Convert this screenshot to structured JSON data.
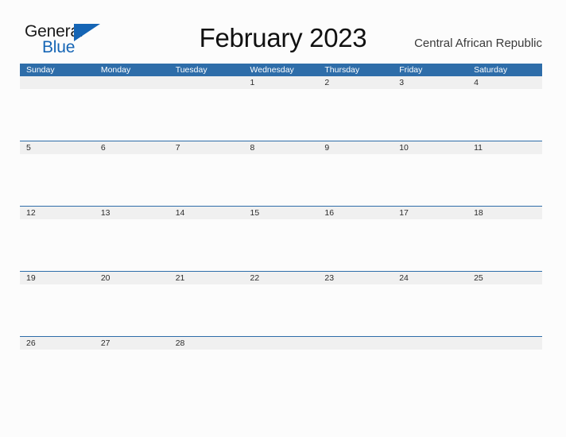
{
  "brand": {
    "name_part1": "General",
    "name_part2": "Blue",
    "flag_icon": "blue-triangle-flag-icon",
    "accent_color": "#1565b5"
  },
  "header": {
    "title": "February 2023",
    "region": "Central African Republic"
  },
  "theme": {
    "header_blue": "#2e6da9",
    "date_band_gray": "#f0f0f0",
    "page_background": "#fcfcfc",
    "date_text": "#2b2b2b",
    "weekday_text": "#ffffff"
  },
  "calendar": {
    "month": "February",
    "year": "2023",
    "weekday_headers": [
      "Sunday",
      "Monday",
      "Tuesday",
      "Wednesday",
      "Thursday",
      "Friday",
      "Saturday"
    ],
    "weeks": [
      {
        "days": [
          "",
          "",
          "",
          "1",
          "2",
          "3",
          "4"
        ]
      },
      {
        "days": [
          "5",
          "6",
          "7",
          "8",
          "9",
          "10",
          "11"
        ]
      },
      {
        "days": [
          "12",
          "13",
          "14",
          "15",
          "16",
          "17",
          "18"
        ]
      },
      {
        "days": [
          "19",
          "20",
          "21",
          "22",
          "23",
          "24",
          "25"
        ]
      },
      {
        "days": [
          "26",
          "27",
          "28",
          "",
          "",
          "",
          ""
        ]
      }
    ]
  }
}
